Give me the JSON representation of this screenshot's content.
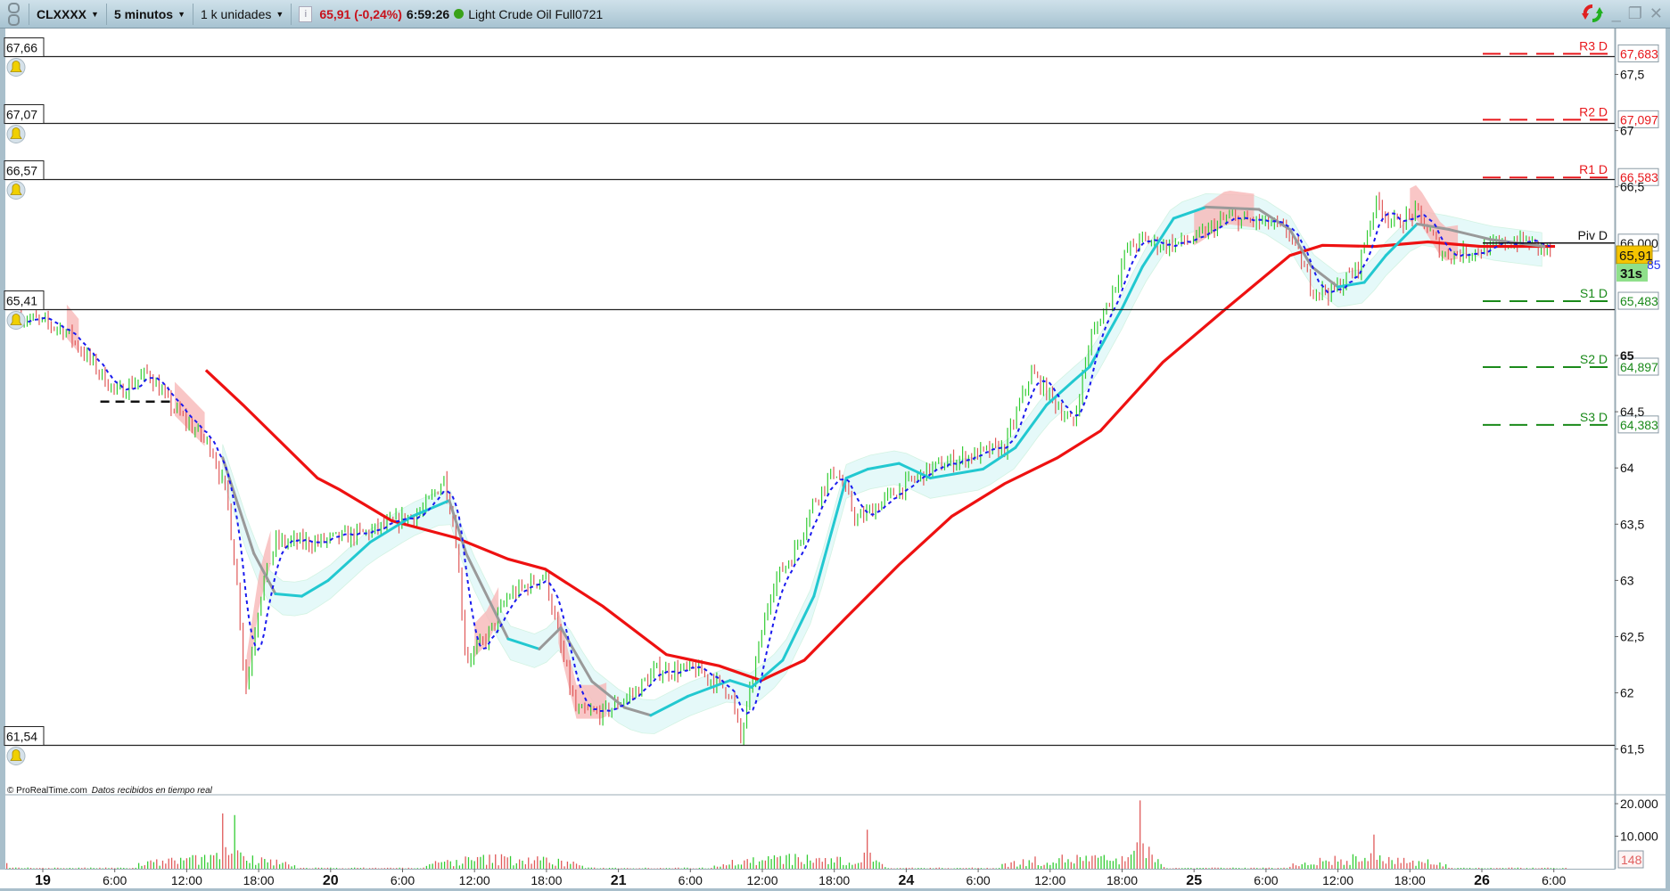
{
  "toolbar": {
    "symbol": "CLXXXX",
    "timeframe": "5 minutos",
    "units": "1 k unidades",
    "info_icon": "i",
    "price_change": "65,91 (-0,24%)",
    "time": "6:59:26",
    "instrument": "Light Crude Oil Full0721"
  },
  "window_controls": {
    "refresh": "refresh-icon",
    "minimize": "_",
    "restore": "❐",
    "close": "✕"
  },
  "alerts": [
    {
      "label": "67,66",
      "price": 67.66
    },
    {
      "label": "67,07",
      "price": 67.07
    },
    {
      "label": "66,57",
      "price": 66.57
    },
    {
      "label": "65,41",
      "price": 65.41
    },
    {
      "label": "61,54",
      "price": 61.54
    }
  ],
  "pivots": [
    {
      "name": "R3 D",
      "label": "67,683",
      "price": 67.683,
      "color": "#e8171b"
    },
    {
      "name": "R2 D",
      "label": "67,097",
      "price": 67.097,
      "color": "#e8171b"
    },
    {
      "name": "R1 D",
      "label": "66,583",
      "price": 66.583,
      "color": "#e8171b"
    },
    {
      "name": "Piv D",
      "label": "66,000",
      "price": 66.0,
      "color": "#111111"
    },
    {
      "name": "S1 D",
      "label": "65,483",
      "price": 65.483,
      "color": "#1a8a1a"
    },
    {
      "name": "S2 D",
      "label": "64,897",
      "price": 64.897,
      "color": "#1a8a1a"
    },
    {
      "name": "S3 D",
      "label": "64,383",
      "price": 64.383,
      "color": "#1a8a1a"
    }
  ],
  "current_price": {
    "label": "65,91",
    "price": 65.91,
    "countdown": "31s",
    "hidden_label": "85"
  },
  "watermark": {
    "brand": "© ProRealTime.com",
    "status": "Datos recibidos en tiempo real"
  },
  "volume_axis": {
    "ticks": [
      {
        "label": "20.000",
        "value": 20000
      },
      {
        "label": "10.000",
        "value": 10000
      }
    ],
    "current": "148"
  },
  "chart_data": {
    "type": "line",
    "title": "CLXXXX 5 minutos",
    "time_unit": "hours since 19 00:00 (trading days consecutive)",
    "price_axis": {
      "ylim": [
        61.3,
        67.9
      ],
      "ticks": [
        {
          "label": "67,5",
          "v": 67.5
        },
        {
          "label": "67",
          "v": 67
        },
        {
          "label": "66,5",
          "v": 66.5
        },
        {
          "label": "65",
          "v": 65,
          "bold": true
        },
        {
          "label": "64,5",
          "v": 64.5
        },
        {
          "label": "64",
          "v": 64
        },
        {
          "label": "63,5",
          "v": 63.5
        },
        {
          "label": "63",
          "v": 63
        },
        {
          "label": "62,5",
          "v": 62.5
        },
        {
          "label": "62",
          "v": 62
        },
        {
          "label": "61,5",
          "v": 61.5
        }
      ]
    },
    "time_ticks": [
      {
        "label": "19",
        "t": 0,
        "bold": true
      },
      {
        "label": "6:00",
        "t": 6
      },
      {
        "label": "12:00",
        "t": 12
      },
      {
        "label": "18:00",
        "t": 18
      },
      {
        "label": "20",
        "t": 24,
        "bold": true
      },
      {
        "label": "6:00",
        "t": 30
      },
      {
        "label": "12:00",
        "t": 36
      },
      {
        "label": "18:00",
        "t": 42
      },
      {
        "label": "21",
        "t": 48,
        "bold": true
      },
      {
        "label": "6:00",
        "t": 54
      },
      {
        "label": "12:00",
        "t": 60
      },
      {
        "label": "18:00",
        "t": 66
      },
      {
        "label": "24",
        "t": 72,
        "bold": true
      },
      {
        "label": "6:00",
        "t": 78
      },
      {
        "label": "12:00",
        "t": 84
      },
      {
        "label": "18:00",
        "t": 90
      },
      {
        "label": "25",
        "t": 96,
        "bold": true
      },
      {
        "label": "6:00",
        "t": 102
      },
      {
        "label": "12:00",
        "t": 108
      },
      {
        "label": "18:00",
        "t": 114
      },
      {
        "label": "26",
        "t": 120,
        "bold": true
      },
      {
        "label": "6:00",
        "t": 126
      }
    ],
    "price": [
      [
        -1.8,
        65.35
      ],
      [
        1.8,
        65.23
      ],
      [
        6.2,
        64.66
      ],
      [
        8.8,
        64.85
      ],
      [
        10.6,
        64.56
      ],
      [
        14.1,
        64.18
      ],
      [
        15.4,
        63.71
      ],
      [
        16.3,
        62.86
      ],
      [
        16.9,
        62.01
      ],
      [
        18.1,
        62.86
      ],
      [
        19.4,
        63.34
      ],
      [
        22.9,
        63.34
      ],
      [
        27.3,
        63.43
      ],
      [
        31.7,
        63.62
      ],
      [
        33.5,
        63.91
      ],
      [
        34.4,
        63.43
      ],
      [
        35.3,
        62.29
      ],
      [
        37.0,
        62.48
      ],
      [
        38.8,
        62.86
      ],
      [
        40.5,
        62.96
      ],
      [
        41.9,
        63.05
      ],
      [
        43.2,
        62.39
      ],
      [
        44.5,
        61.82
      ],
      [
        46.7,
        61.82
      ],
      [
        49.4,
        62.01
      ],
      [
        51.1,
        62.2
      ],
      [
        54.6,
        62.2
      ],
      [
        57.3,
        62.01
      ],
      [
        58.2,
        61.58
      ],
      [
        59.5,
        62.29
      ],
      [
        60.8,
        62.96
      ],
      [
        62.6,
        63.24
      ],
      [
        64.3,
        63.71
      ],
      [
        66.1,
        63.99
      ],
      [
        67.9,
        63.53
      ],
      [
        71.4,
        63.81
      ],
      [
        74.0,
        63.99
      ],
      [
        76.7,
        64.09
      ],
      [
        80.2,
        64.18
      ],
      [
        82.4,
        64.85
      ],
      [
        84.6,
        64.56
      ],
      [
        85.9,
        64.37
      ],
      [
        87.3,
        65.13
      ],
      [
        89.0,
        65.51
      ],
      [
        90.4,
        65.94
      ],
      [
        91.7,
        66.03
      ],
      [
        93.4,
        65.98
      ],
      [
        96.1,
        66.03
      ],
      [
        98.7,
        66.22
      ],
      [
        102.3,
        66.17
      ],
      [
        104.0,
        66.08
      ],
      [
        105.8,
        65.6
      ],
      [
        107.5,
        65.56
      ],
      [
        109.7,
        65.79
      ],
      [
        111.1,
        66.36
      ],
      [
        112.8,
        66.17
      ],
      [
        114.6,
        66.27
      ],
      [
        116.8,
        65.89
      ],
      [
        119.9,
        65.94
      ],
      [
        123.4,
        66.03
      ],
      [
        125.9,
        65.91
      ]
    ],
    "series": [
      {
        "name": "MA slow",
        "color": "#ee1111",
        "points": [
          [
            13.6,
            64.87
          ],
          [
            16.7,
            64.56
          ],
          [
            22.9,
            63.91
          ],
          [
            24.7,
            63.81
          ],
          [
            29.1,
            63.53
          ],
          [
            34.4,
            63.38
          ],
          [
            38.8,
            63.19
          ],
          [
            41.9,
            63.1
          ],
          [
            46.7,
            62.77
          ],
          [
            52.0,
            62.34
          ],
          [
            56.4,
            62.24
          ],
          [
            59.9,
            62.11
          ],
          [
            63.5,
            62.29
          ],
          [
            67.0,
            62.67
          ],
          [
            71.4,
            63.14
          ],
          [
            75.8,
            63.57
          ],
          [
            80.2,
            63.86
          ],
          [
            84.6,
            64.09
          ],
          [
            88.2,
            64.33
          ],
          [
            93.4,
            64.94
          ],
          [
            98.7,
            65.42
          ],
          [
            104.0,
            65.89
          ],
          [
            106.7,
            65.98
          ],
          [
            111.1,
            65.97
          ],
          [
            115.5,
            66.01
          ],
          [
            119.9,
            65.97
          ],
          [
            126.1,
            65.97
          ]
        ]
      },
      {
        "name": "MA medium",
        "color": "#22c8d0",
        "down_color": "#999999",
        "points": [
          [
            15.0,
            64.09,
            0
          ],
          [
            17.6,
            63.24,
            0
          ],
          [
            19.4,
            62.88,
            0
          ],
          [
            21.6,
            62.86,
            1
          ],
          [
            23.8,
            63.0,
            1
          ],
          [
            27.3,
            63.34,
            1
          ],
          [
            30.8,
            63.57,
            1
          ],
          [
            33.9,
            63.71,
            1
          ],
          [
            35.3,
            63.24,
            0
          ],
          [
            38.8,
            62.48,
            0
          ],
          [
            41.4,
            62.39,
            1
          ],
          [
            43.2,
            62.58,
            0
          ],
          [
            45.8,
            62.1,
            0
          ],
          [
            48.5,
            61.87,
            0
          ],
          [
            50.7,
            61.8,
            0
          ],
          [
            53.8,
            61.97,
            1
          ],
          [
            57.3,
            62.11,
            1
          ],
          [
            59.1,
            62.05,
            1
          ],
          [
            61.7,
            62.29,
            1
          ],
          [
            64.3,
            62.86,
            1
          ],
          [
            67.0,
            63.91,
            1
          ],
          [
            68.8,
            63.99,
            1
          ],
          [
            71.4,
            64.04,
            1
          ],
          [
            74.0,
            63.91,
            1
          ],
          [
            78.4,
            63.99,
            1
          ],
          [
            81.1,
            64.18,
            1
          ],
          [
            83.7,
            64.56,
            1
          ],
          [
            85.9,
            64.77,
            1
          ],
          [
            87.3,
            64.9,
            1
          ],
          [
            90.0,
            65.42,
            1
          ],
          [
            91.7,
            65.79,
            1
          ],
          [
            94.3,
            66.22,
            1
          ],
          [
            97.0,
            66.32,
            1
          ],
          [
            101.4,
            66.3,
            0
          ],
          [
            104.0,
            66.12,
            0
          ],
          [
            105.8,
            65.79,
            0
          ],
          [
            108.0,
            65.61,
            0
          ],
          [
            110.2,
            65.65,
            1
          ],
          [
            112.0,
            65.89,
            1
          ],
          [
            114.6,
            66.17,
            1
          ],
          [
            117.3,
            66.12,
            0
          ],
          [
            120.8,
            66.03,
            0
          ],
          [
            125.2,
            65.97,
            0
          ]
        ]
      },
      {
        "name": "MA fast (dotted)",
        "color": "#1a1aee"
      }
    ],
    "support_segment": {
      "t": [
        4.8,
        11.0
      ],
      "price": 64.59
    },
    "volume_peaks": [
      [
        15.0,
        17000
      ],
      [
        16.0,
        16500
      ],
      [
        68.7,
        12000
      ],
      [
        91.6,
        21000
      ],
      [
        111.0,
        10500
      ]
    ]
  },
  "colors": {
    "up": "#33cc33",
    "down": "#e05a5a",
    "grid_line": "#222222"
  }
}
